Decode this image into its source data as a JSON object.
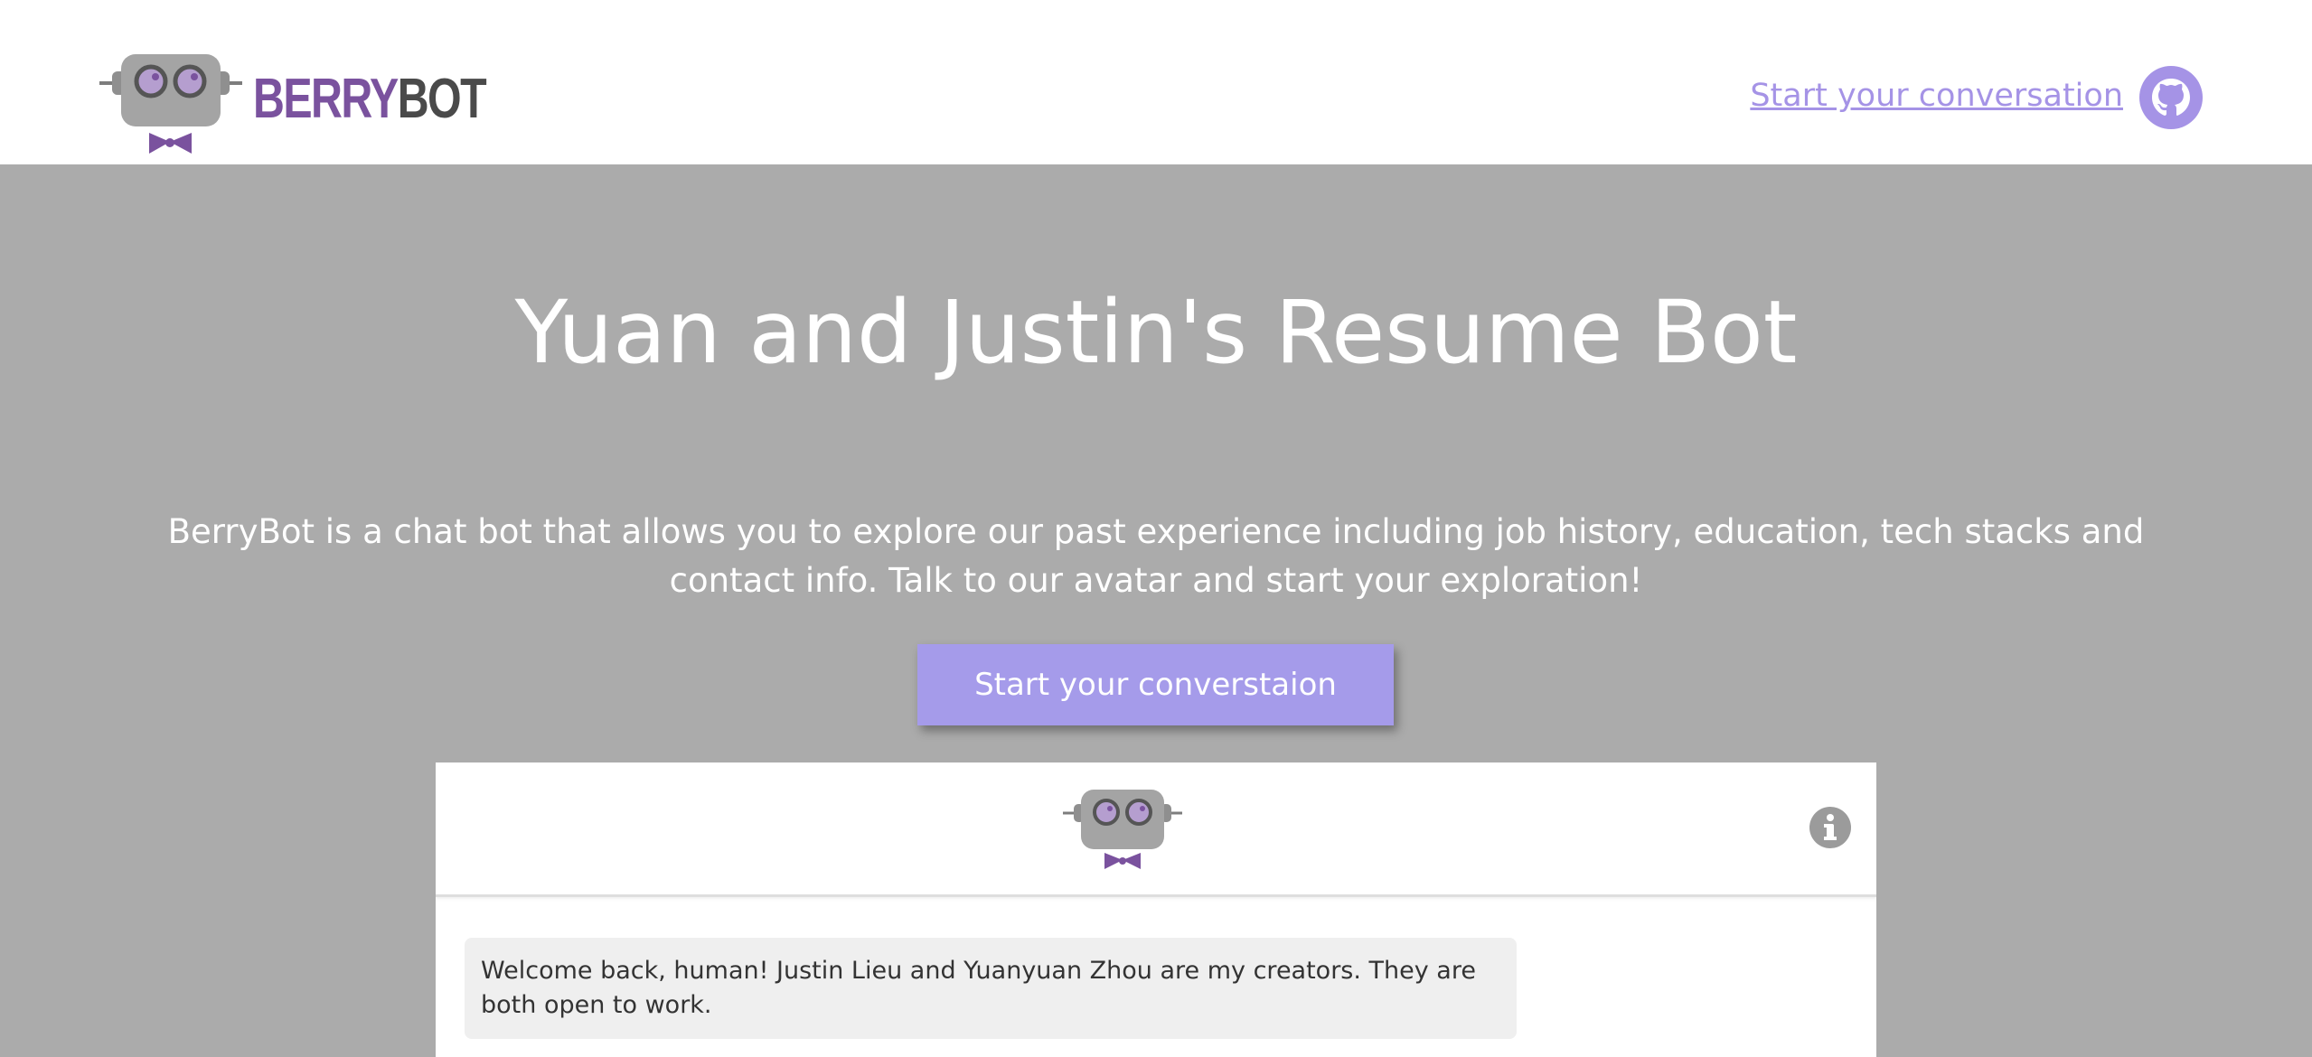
{
  "header": {
    "logo": {
      "text_part1": "BERRY",
      "text_part2": "BOT"
    },
    "nav_link": "Start your conversation",
    "github_icon": "github-icon"
  },
  "hero": {
    "title": "Yuan and Justin's Resume Bot",
    "description": "BerryBot is a chat bot that allows you to explore our past experience including job history, education, tech stacks and contact info. Talk to our avatar and start your exploration!",
    "cta_label": "Start your converstaion"
  },
  "chat": {
    "avatar_icon": "robot-icon",
    "info_icon": "info-icon",
    "messages": [
      {
        "sender": "bot",
        "text": "Welcome back, human! Justin Lieu and Yuanyuan Zhou are my creators. They are both open to work."
      }
    ]
  },
  "colors": {
    "accent": "#a59bea",
    "link": "#a593e6",
    "brand_purple": "#7a529e",
    "hero_background": "#ababab",
    "bubble_background": "#efefef"
  }
}
